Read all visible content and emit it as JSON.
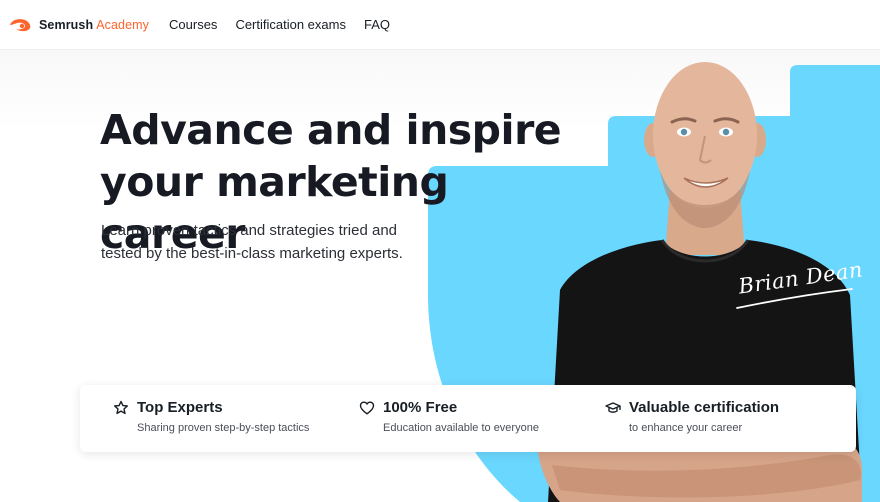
{
  "header": {
    "brand": "Semrush",
    "brand_accent": "Academy",
    "nav": [
      "Courses",
      "Certification exams",
      "FAQ"
    ]
  },
  "hero": {
    "headline_line1": "Advance and inspire",
    "headline_line2": "your marketing career",
    "subtext": "Learn proven tactics and strategies tried and tested by the best-in-class marketing experts.",
    "signature": "Brian Dean"
  },
  "features": [
    {
      "icon": "star-icon",
      "title": "Top Experts",
      "desc": "Sharing proven step-by-step tactics"
    },
    {
      "icon": "heart-icon",
      "title": "100% Free",
      "desc": "Education available to everyone"
    },
    {
      "icon": "graduation-cap-icon",
      "title": "Valuable certification",
      "desc": "to enhance your career"
    }
  ],
  "colors": {
    "brand_orange": "#ff642d",
    "hero_blue": "#6ad7fe",
    "text_dark": "#181e25",
    "shirt": "#141414",
    "skin": "#e4b79c"
  }
}
